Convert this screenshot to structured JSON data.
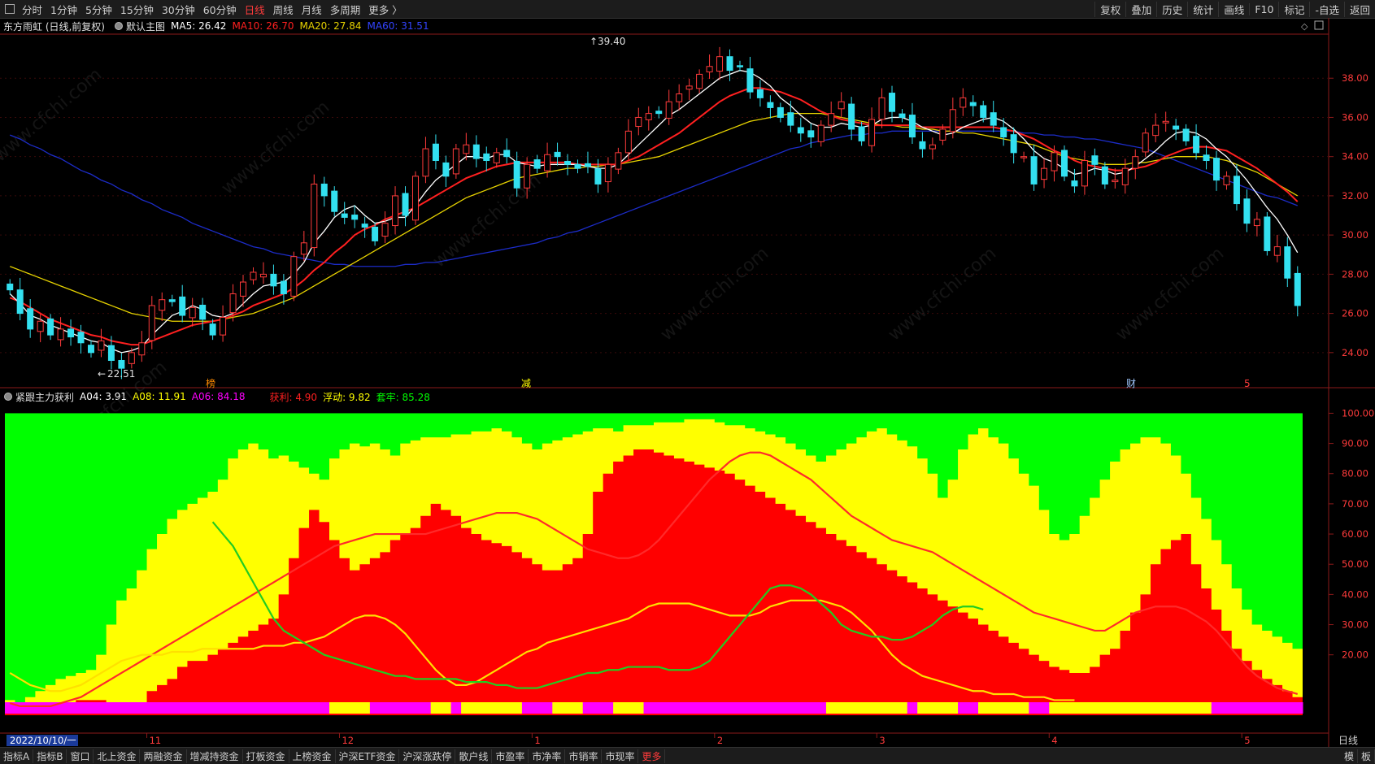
{
  "toolbar": {
    "periods": [
      "分时",
      "1分钟",
      "5分钟",
      "15分钟",
      "30分钟",
      "60分钟",
      "日线",
      "周线",
      "月线",
      "多周期",
      "更多 〉"
    ],
    "active_period": "日线",
    "right_buttons": [
      "复权",
      "叠加",
      "历史",
      "统计",
      "画线",
      "F10",
      "标记",
      "-自选",
      "返回"
    ]
  },
  "main_legend": {
    "stock": "东方雨虹 (日线,前复权)",
    "template": "默认主图",
    "ma5": "MA5: 26.42",
    "ma10": "MA10: 26.70",
    "ma20": "MA20: 27.84",
    "ma60": "MA60: 31.51"
  },
  "sub_legend": {
    "name": "紧跟主力获利",
    "a04": "A04: 3.91",
    "a08": "A08: 11.91",
    "a06": "A06: 84.18",
    "huoli": "获利: 4.90",
    "fudong": "浮动: 9.82",
    "taolv": "套牢: 85.28"
  },
  "markers": {
    "high": "39.40",
    "low": "22.51",
    "bang": "榜",
    "jian": "减",
    "cai": "财",
    "five": "5"
  },
  "date_axis": {
    "start": "2022/10/10/一",
    "months": [
      "11",
      "12",
      "1",
      "2",
      "3",
      "4",
      "5"
    ],
    "period_btn": "日线"
  },
  "bottom_tabs": [
    "指标A",
    "指标B",
    "窗口",
    "北上资金",
    "两融资金",
    "增减持资金",
    "打板资金",
    "上榜资金",
    "沪深ETF资金",
    "沪深涨跌停",
    "散户线",
    "市盈率",
    "市净率",
    "市销率",
    "市现率",
    "更多"
  ],
  "bottom_right": [
    "模",
    "板"
  ],
  "colors": {
    "ma5": "#ffffff",
    "ma10": "#ff2020",
    "ma20": "#e6d200",
    "ma60": "#1c2cc8",
    "up": "#ff3b3b",
    "down": "#33e0f0",
    "green_zone": "#00ff00",
    "yellow_zone": "#ffff00",
    "red_zone": "#ff0000",
    "magenta": "#ff00ff"
  },
  "chart_data": [
    {
      "type": "candlestick",
      "title": "东方雨虹 (日线,前复权)",
      "y_ticks": [
        "38.00",
        "36.00",
        "34.00",
        "32.00",
        "30.00",
        "28.00",
        "26.00",
        "24.00"
      ],
      "ylim": [
        22.5,
        40
      ],
      "n": 128,
      "close": [
        27.2,
        26.0,
        25.2,
        25.6,
        24.9,
        25.2,
        24.8,
        24.5,
        24.0,
        24.6,
        23.6,
        23.2,
        24.0,
        24.5,
        26.4,
        26.7,
        26.6,
        25.9,
        26.3,
        25.7,
        24.9,
        25.8,
        27.0,
        27.6,
        28.1,
        28.0,
        27.4,
        27.0,
        28.9,
        29.6,
        32.6,
        32.0,
        31.2,
        30.9,
        30.8,
        30.4,
        29.7,
        30.6,
        32.0,
        31.0,
        33.0,
        34.4,
        33.8,
        33.0,
        34.4,
        34.6,
        33.9,
        33.8,
        34.2,
        34.0,
        32.4,
        33.6,
        33.4,
        34.1,
        34.0,
        33.6,
        33.4,
        33.5,
        32.6,
        33.6,
        34.2,
        35.3,
        36.0,
        36.2,
        36.2,
        36.8,
        37.2,
        37.6,
        38.2,
        38.6,
        39.1,
        38.4,
        38.6,
        37.3,
        37.0,
        36.5,
        36.0,
        35.6,
        35.2,
        35.0,
        35.6,
        36.2,
        36.8,
        35.4,
        34.8,
        35.9,
        37.0,
        36.3,
        36.0,
        35.0,
        34.4,
        34.6,
        35.4,
        36.4,
        37.0,
        36.6,
        36.0,
        35.6,
        35.0,
        34.2,
        34.0,
        32.6,
        33.4,
        34.2,
        33.0,
        32.5,
        33.8,
        33.6,
        32.6,
        32.8,
        33.4,
        34.0,
        35.2,
        35.6,
        35.8,
        35.4,
        34.8,
        34.2,
        33.8,
        32.8,
        33.0,
        31.6,
        30.6,
        30.8,
        29.2,
        29.4,
        27.8,
        26.4
      ],
      "ma5": [
        27.0,
        26.5,
        25.9,
        25.7,
        25.4,
        25.2,
        25.0,
        24.8,
        24.6,
        24.5,
        24.2,
        24.0,
        24.1,
        24.3,
        24.9,
        25.4,
        25.9,
        26.1,
        26.4,
        26.2,
        25.9,
        25.8,
        26.0,
        26.5,
        27.0,
        27.4,
        27.5,
        27.6,
        28.0,
        28.6,
        29.6,
        30.2,
        30.9,
        31.3,
        31.5,
        31.0,
        30.6,
        30.7,
        30.9,
        30.9,
        31.5,
        32.2,
        32.8,
        33.2,
        33.6,
        34.0,
        34.0,
        33.9,
        34.1,
        34.1,
        33.7,
        33.6,
        33.5,
        33.6,
        33.6,
        33.6,
        33.6,
        33.5,
        33.4,
        33.4,
        33.6,
        34.1,
        34.6,
        35.1,
        35.6,
        36.1,
        36.4,
        36.8,
        37.2,
        37.6,
        38.0,
        38.2,
        38.4,
        38.3,
        38.0,
        37.6,
        37.0,
        36.6,
        36.1,
        35.7,
        35.5,
        35.5,
        35.7,
        35.6,
        35.5,
        35.6,
        35.9,
        36.0,
        36.0,
        35.8,
        35.5,
        35.3,
        35.1,
        35.2,
        35.5,
        35.7,
        35.9,
        36.0,
        35.8,
        35.4,
        34.9,
        34.3,
        33.9,
        33.7,
        33.4,
        33.1,
        33.2,
        33.4,
        33.3,
        33.1,
        33.2,
        33.5,
        33.9,
        34.3,
        34.8,
        35.2,
        35.3,
        35.2,
        34.9,
        34.4,
        34.0,
        33.4,
        32.8,
        32.1,
        31.4,
        30.8,
        30.0,
        29.1
      ],
      "ma10": [
        26.8,
        26.6,
        26.3,
        26.0,
        25.7,
        25.5,
        25.3,
        25.1,
        24.9,
        24.8,
        24.6,
        24.5,
        24.4,
        24.4,
        24.6,
        24.8,
        25.0,
        25.2,
        25.4,
        25.5,
        25.6,
        25.7,
        25.9,
        26.1,
        26.4,
        26.6,
        26.8,
        27.0,
        27.3,
        27.7,
        28.2,
        28.6,
        29.1,
        29.5,
        30.0,
        30.3,
        30.5,
        30.8,
        31.0,
        31.2,
        31.4,
        31.7,
        32.0,
        32.3,
        32.6,
        32.9,
        33.1,
        33.3,
        33.5,
        33.6,
        33.7,
        33.7,
        33.7,
        33.7,
        33.7,
        33.7,
        33.6,
        33.6,
        33.6,
        33.6,
        33.6,
        33.8,
        34.0,
        34.3,
        34.6,
        34.9,
        35.2,
        35.6,
        36.0,
        36.4,
        36.8,
        37.1,
        37.3,
        37.5,
        37.5,
        37.4,
        37.3,
        37.1,
        36.9,
        36.6,
        36.3,
        36.1,
        35.9,
        35.8,
        35.7,
        35.6,
        35.6,
        35.6,
        35.6,
        35.6,
        35.5,
        35.5,
        35.5,
        35.5,
        35.5,
        35.5,
        35.5,
        35.5,
        35.4,
        35.3,
        35.1,
        34.9,
        34.6,
        34.3,
        34.1,
        33.8,
        33.6,
        33.5,
        33.4,
        33.3,
        33.3,
        33.4,
        33.5,
        33.7,
        34.0,
        34.2,
        34.4,
        34.5,
        34.5,
        34.4,
        34.3,
        34.0,
        33.7,
        33.4,
        33.0,
        32.6,
        32.2,
        31.7
      ],
      "ma20": [
        28.4,
        28.2,
        28.0,
        27.8,
        27.6,
        27.4,
        27.2,
        27.0,
        26.8,
        26.6,
        26.4,
        26.2,
        26.0,
        25.9,
        25.8,
        25.7,
        25.6,
        25.6,
        25.6,
        25.6,
        25.6,
        25.7,
        25.8,
        25.9,
        26.0,
        26.2,
        26.4,
        26.6,
        26.8,
        27.1,
        27.4,
        27.7,
        28.0,
        28.3,
        28.6,
        28.9,
        29.2,
        29.5,
        29.8,
        30.1,
        30.4,
        30.7,
        31.0,
        31.3,
        31.6,
        31.9,
        32.1,
        32.3,
        32.5,
        32.7,
        32.9,
        33.0,
        33.1,
        33.2,
        33.3,
        33.4,
        33.4,
        33.5,
        33.5,
        33.6,
        33.6,
        33.7,
        33.8,
        33.9,
        34.0,
        34.2,
        34.4,
        34.6,
        34.8,
        35.0,
        35.2,
        35.4,
        35.6,
        35.8,
        35.9,
        36.0,
        36.1,
        36.2,
        36.2,
        36.2,
        36.2,
        36.1,
        36.0,
        35.9,
        35.8,
        35.7,
        35.6,
        35.6,
        35.5,
        35.5,
        35.4,
        35.4,
        35.3,
        35.3,
        35.2,
        35.2,
        35.1,
        35.0,
        34.9,
        34.8,
        34.7,
        34.6,
        34.4,
        34.2,
        34.0,
        33.9,
        33.8,
        33.7,
        33.6,
        33.6,
        33.6,
        33.7,
        33.7,
        33.8,
        33.9,
        34.0,
        34.0,
        34.0,
        34.0,
        33.9,
        33.8,
        33.6,
        33.4,
        33.2,
        32.9,
        32.6,
        32.3,
        32.0
      ],
      "ma60": [
        35.1,
        34.9,
        34.6,
        34.4,
        34.1,
        33.9,
        33.6,
        33.3,
        33.1,
        32.8,
        32.6,
        32.3,
        32.1,
        31.8,
        31.6,
        31.3,
        31.1,
        30.9,
        30.6,
        30.4,
        30.2,
        30.0,
        29.8,
        29.6,
        29.4,
        29.3,
        29.1,
        29.0,
        28.9,
        28.8,
        28.7,
        28.6,
        28.5,
        28.5,
        28.4,
        28.4,
        28.4,
        28.4,
        28.4,
        28.5,
        28.5,
        28.6,
        28.6,
        28.7,
        28.8,
        28.9,
        29.0,
        29.1,
        29.2,
        29.3,
        29.4,
        29.5,
        29.6,
        29.8,
        29.9,
        30.1,
        30.2,
        30.4,
        30.6,
        30.8,
        31.0,
        31.2,
        31.4,
        31.6,
        31.8,
        32.0,
        32.2,
        32.4,
        32.6,
        32.8,
        33.0,
        33.2,
        33.4,
        33.6,
        33.8,
        34.0,
        34.2,
        34.4,
        34.5,
        34.7,
        34.8,
        34.9,
        35.0,
        35.1,
        35.1,
        35.2,
        35.2,
        35.3,
        35.3,
        35.3,
        35.3,
        35.3,
        35.3,
        35.3,
        35.3,
        35.3,
        35.3,
        35.3,
        35.3,
        35.3,
        35.2,
        35.2,
        35.1,
        35.1,
        35.0,
        35.0,
        34.9,
        34.9,
        34.8,
        34.7,
        34.6,
        34.5,
        34.4,
        34.2,
        34.0,
        33.8,
        33.6,
        33.4,
        33.2,
        33.0,
        32.8,
        32.6,
        32.4,
        32.2,
        32.0,
        31.9,
        31.7,
        31.5
      ]
    },
    {
      "type": "area",
      "title": "紧跟主力获利",
      "y_ticks": [
        "100.00",
        "90.00",
        "80.00",
        "70.00",
        "60.00",
        "50.00",
        "40.00",
        "30.00",
        "20.00"
      ],
      "ylim": [
        0,
        102
      ],
      "n": 128,
      "yellow": [
        5,
        4,
        6,
        8,
        10,
        12,
        13,
        14,
        15,
        20,
        30,
        38,
        42,
        48,
        55,
        60,
        65,
        68,
        70,
        72,
        74,
        78,
        85,
        88,
        90,
        88,
        85,
        86,
        84,
        82,
        80,
        78,
        85,
        88,
        90,
        89,
        90,
        88,
        86,
        90,
        91,
        92,
        92,
        92,
        93,
        93,
        94,
        94,
        95,
        94,
        92,
        90,
        88,
        90,
        91,
        92,
        93,
        94,
        95,
        95,
        94,
        96,
        96,
        96,
        97,
        97,
        97,
        98,
        98,
        98,
        97,
        96,
        96,
        95,
        94,
        93,
        92,
        90,
        88,
        86,
        84,
        86,
        88,
        90,
        92,
        94,
        95,
        93,
        91,
        89,
        85,
        80,
        72,
        78,
        88,
        93,
        95,
        92,
        90,
        85,
        80,
        76,
        68,
        60,
        58,
        60,
        66,
        72,
        78,
        84,
        88,
        90,
        92,
        92,
        90,
        86,
        80,
        72,
        65,
        58,
        50,
        42,
        35,
        30,
        28,
        26,
        24,
        22
      ],
      "red": [
        3,
        2,
        2,
        3,
        3,
        3,
        4,
        5,
        5,
        5,
        4,
        3,
        3,
        4,
        8,
        10,
        12,
        16,
        18,
        18,
        20,
        22,
        24,
        26,
        28,
        30,
        32,
        40,
        52,
        62,
        68,
        64,
        58,
        52,
        48,
        50,
        52,
        54,
        58,
        60,
        62,
        66,
        70,
        68,
        66,
        62,
        60,
        58,
        57,
        56,
        54,
        52,
        50,
        48,
        48,
        50,
        52,
        60,
        74,
        80,
        84,
        86,
        88,
        88,
        87,
        86,
        85,
        84,
        83,
        82,
        81,
        80,
        78,
        76,
        74,
        72,
        70,
        68,
        66,
        64,
        62,
        60,
        58,
        56,
        54,
        52,
        50,
        48,
        46,
        44,
        42,
        40,
        38,
        36,
        34,
        32,
        30,
        28,
        26,
        24,
        22,
        20,
        18,
        16,
        15,
        14,
        14,
        16,
        20,
        22,
        28,
        34,
        40,
        50,
        55,
        58,
        60,
        50,
        42,
        35,
        28,
        22,
        18,
        15,
        12,
        10,
        8,
        6
      ],
      "yellow_line": [
        14,
        12,
        10,
        9,
        8,
        8,
        9,
        10,
        12,
        14,
        16,
        18,
        19,
        20,
        20,
        20,
        21,
        21,
        21,
        22,
        22,
        22,
        22,
        22,
        22,
        23,
        23,
        23,
        24,
        24,
        25,
        26,
        28,
        30,
        32,
        33,
        33,
        32,
        30,
        27,
        23,
        19,
        15,
        12,
        10,
        10,
        11,
        13,
        15,
        17,
        19,
        21,
        22,
        24,
        25,
        26,
        27,
        28,
        29,
        30,
        31,
        32,
        34,
        36,
        37,
        37,
        37,
        37,
        36,
        35,
        34,
        33,
        33,
        33,
        34,
        36,
        37,
        38,
        38,
        38,
        38,
        37,
        36,
        34,
        31,
        28,
        24,
        20,
        17,
        15,
        13,
        12,
        11,
        10,
        9,
        8,
        8,
        7,
        7,
        7,
        6,
        6,
        6,
        5,
        5,
        5
      ],
      "red_line": [
        4,
        3,
        3,
        3,
        3,
        4,
        5,
        6,
        8,
        10,
        12,
        14,
        16,
        18,
        20,
        22,
        24,
        26,
        28,
        30,
        32,
        34,
        36,
        38,
        40,
        42,
        44,
        46,
        48,
        50,
        52,
        54,
        56,
        57,
        58,
        59,
        60,
        60,
        60,
        60,
        60,
        60,
        61,
        62,
        63,
        64,
        65,
        66,
        67,
        67,
        67,
        66,
        65,
        63,
        61,
        59,
        57,
        55,
        54,
        53,
        52,
        52,
        53,
        55,
        58,
        62,
        66,
        70,
        74,
        78,
        81,
        84,
        86,
        87,
        87,
        86,
        84,
        82,
        80,
        78,
        75,
        72,
        69,
        66,
        64,
        62,
        60,
        58,
        57,
        56,
        55,
        54,
        52,
        50,
        48,
        46,
        44,
        42,
        40,
        38,
        36,
        34,
        33,
        32,
        31,
        30,
        29,
        28,
        28,
        30,
        32,
        34,
        35,
        36,
        36,
        36,
        35,
        33,
        31,
        28,
        24,
        20,
        16,
        13,
        11,
        9,
        8,
        7
      ],
      "green_line": [
        64,
        60,
        56,
        50,
        44,
        38,
        32,
        28,
        26,
        24,
        22,
        20,
        19,
        18,
        17,
        16,
        15,
        14,
        13,
        13,
        12,
        12,
        12,
        12,
        12,
        11,
        11,
        11,
        10,
        10,
        9,
        9,
        9,
        10,
        11,
        12,
        13,
        14,
        14,
        15,
        15,
        16,
        16,
        16,
        16,
        15,
        15,
        15,
        16,
        18,
        22,
        26,
        30,
        34,
        38,
        42,
        43,
        43,
        42,
        40,
        37,
        34,
        30,
        28,
        27,
        26,
        26,
        25,
        25,
        26,
        28,
        30,
        33,
        35,
        36,
        36,
        35
      ]
    }
  ]
}
